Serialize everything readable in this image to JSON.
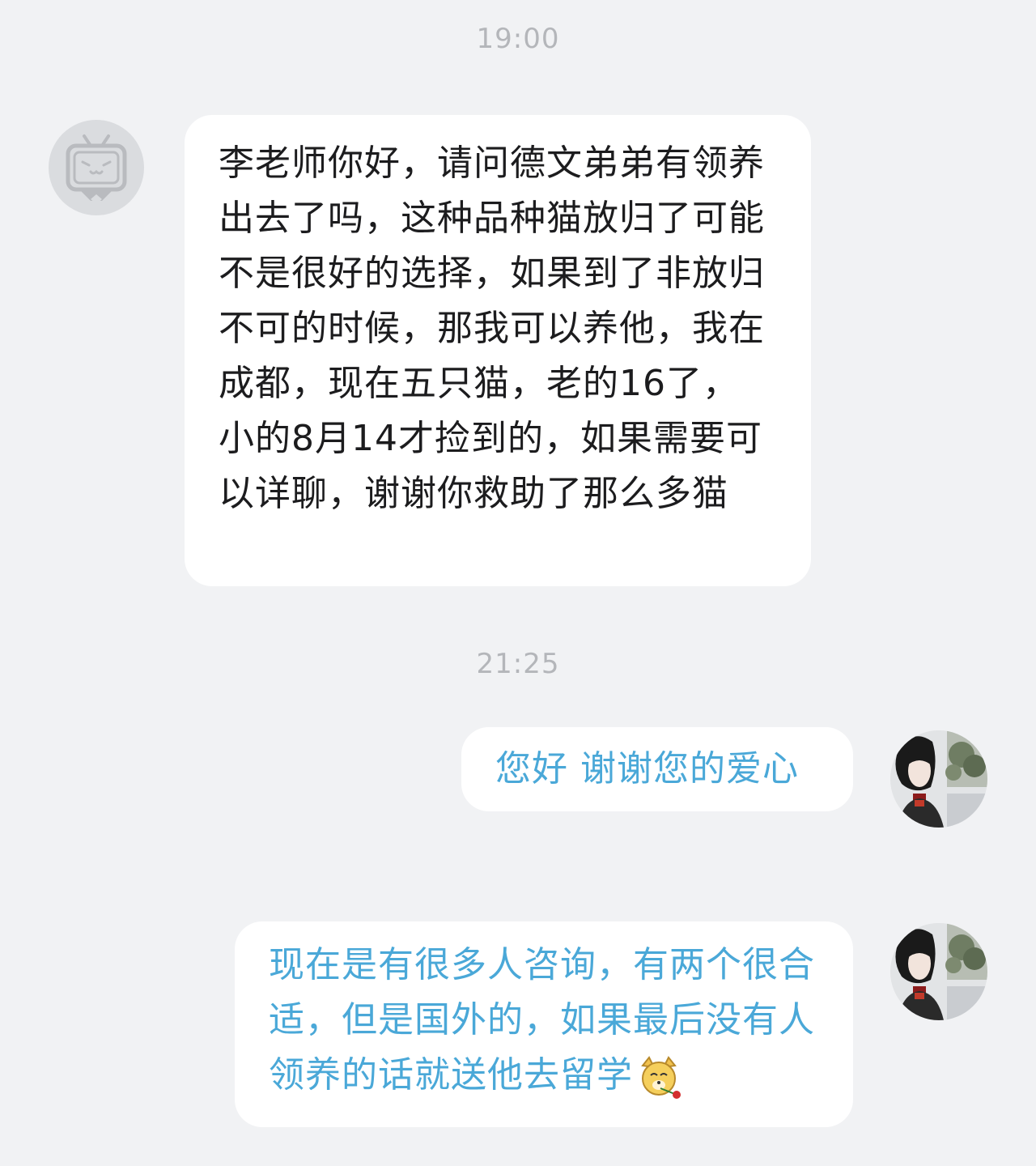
{
  "timestamps": [
    "19:00",
    "21:25"
  ],
  "messages": [
    {
      "side": "incoming",
      "text": "李老师你好，请问德文弟弟有领养出去了吗，这种品种猫放归了可能不是很好的选择，如果到了非放归不可的时候，那我可以养他，我在成都，现在五只猫，老的16了，小的8月14才捡到的，如果需要可以详聊，谢谢你救助了那么多猫"
    },
    {
      "side": "outgoing",
      "text": "您好 谢谢您的爱心"
    },
    {
      "side": "outgoing",
      "text": "现在是有很多人咨询，有两个很合适，但是国外的，如果最后没有人领养的话就送他去留学",
      "emoji": "cat-with-rose-emoji"
    }
  ],
  "colors": {
    "background": "#f1f2f4",
    "bubble": "#ffffff",
    "incoming_text": "#1c1c1e",
    "outgoing_text": "#4aa8d8",
    "timestamp": "#b4b6ba"
  },
  "avatars": {
    "sender": "bilibili-tv-icon",
    "self": "profile-photo"
  }
}
